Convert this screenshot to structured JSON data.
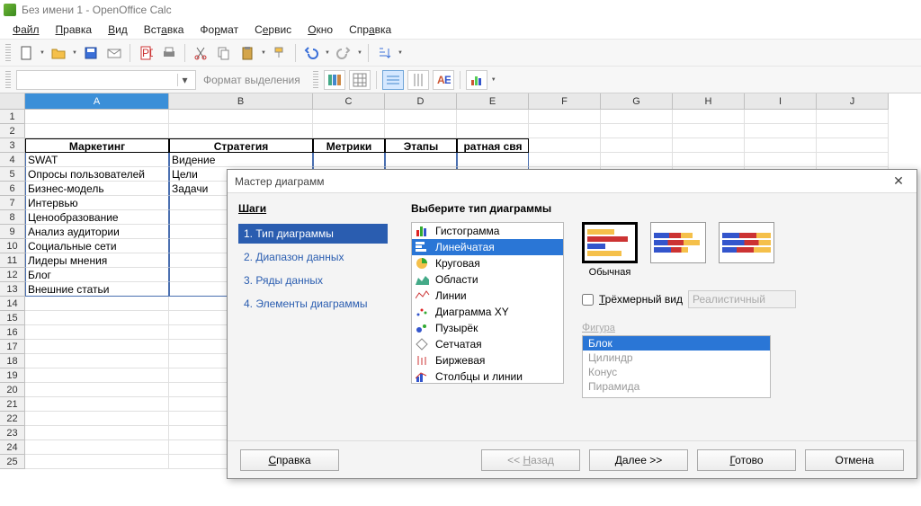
{
  "window": {
    "title": "Без имени 1 - OpenOffice Calc"
  },
  "menu": {
    "file": "Файл",
    "edit": "Правка",
    "view": "Вид",
    "insert": "Вставка",
    "format": "Формат",
    "tools": "Сервис",
    "window": "Окно",
    "help": "Справка"
  },
  "toolbar2": {
    "format_selection": "Формат выделения"
  },
  "columns": [
    "A",
    "B",
    "C",
    "D",
    "E",
    "F",
    "G",
    "H",
    "I",
    "J"
  ],
  "rows": [
    1,
    2,
    3,
    4,
    5,
    6,
    7,
    8,
    9,
    10,
    11,
    12,
    13,
    14,
    15,
    16,
    17,
    18,
    19,
    20,
    21,
    22,
    23,
    24,
    25
  ],
  "table": {
    "headers": {
      "a": "Маркетинг",
      "b": "Стратегия",
      "c": "Метрики",
      "d": "Этапы",
      "e": "ратная свя"
    },
    "colA": [
      "SWAT",
      "Опросы пользователей",
      "Бизнес-модель",
      "Интервью",
      "Ценообразование",
      "Анализ аудитории",
      "Социальные сети",
      "Лидеры мнения",
      "Блог",
      "Внешние статьи"
    ],
    "colB": [
      "Видение",
      "Цели",
      "Задачи"
    ]
  },
  "dialog": {
    "title": "Мастер диаграмм",
    "steps_title": "Шаги",
    "steps": [
      "1. Тип диаграммы",
      "2. Диапазон данных",
      "3. Ряды данных",
      "4. Элементы диаграммы"
    ],
    "choose_type": "Выберите тип диаграммы",
    "types": [
      "Гистограмма",
      "Линейчатая",
      "Круговая",
      "Области",
      "Линии",
      "Диаграмма XY",
      "Пузырёк",
      "Сетчатая",
      "Биржевая",
      "Столбцы и линии"
    ],
    "subtype_label": "Обычная",
    "threeD": "Трёхмерный вид",
    "threeD_combo": "Реалистичный",
    "shape_label": "Фигура",
    "shapes": [
      "Блок",
      "Цилиндр",
      "Конус",
      "Пирамида"
    ],
    "buttons": {
      "help": "Справка",
      "back": "<< Назад",
      "next": "Далее >>",
      "finish": "Готово",
      "cancel": "Отмена"
    }
  }
}
